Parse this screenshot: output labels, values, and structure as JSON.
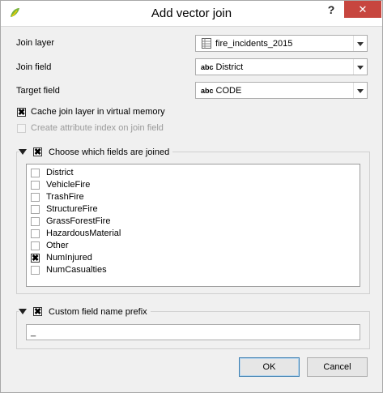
{
  "window": {
    "title": "Add vector join",
    "help_label": "?",
    "close_label": "✕"
  },
  "form": {
    "join_layer": {
      "label": "Join layer",
      "value": "fire_incidents_2015"
    },
    "join_field": {
      "label": "Join field",
      "type_tag": "abc",
      "value": "District"
    },
    "target_field": {
      "label": "Target field",
      "type_tag": "abc",
      "value": "CODE"
    },
    "cache_join": {
      "label": "Cache join layer in virtual memory",
      "checked": true
    },
    "create_index": {
      "label": "Create attribute index on join field",
      "checked": false,
      "enabled": false
    }
  },
  "fields_group": {
    "title": "Choose which fields are joined",
    "checked": true,
    "fields": [
      {
        "name": "District",
        "checked": false
      },
      {
        "name": "VehicleFire",
        "checked": false
      },
      {
        "name": "TrashFire",
        "checked": false
      },
      {
        "name": "StructureFire",
        "checked": false
      },
      {
        "name": "GrassForestFire",
        "checked": false
      },
      {
        "name": "HazardousMaterial",
        "checked": false
      },
      {
        "name": "Other",
        "checked": false
      },
      {
        "name": "NumInjured",
        "checked": true
      },
      {
        "name": "NumCasualties",
        "checked": false
      }
    ]
  },
  "prefix_group": {
    "title": "Custom field name prefix",
    "checked": true,
    "value": "_"
  },
  "buttons": {
    "ok": "OK",
    "cancel": "Cancel"
  },
  "icons": {
    "app": "qgis-icon",
    "layer": "table-layer-icon",
    "collapse": "collapse-triangle-icon",
    "dropdown": "chevron-down-icon"
  }
}
